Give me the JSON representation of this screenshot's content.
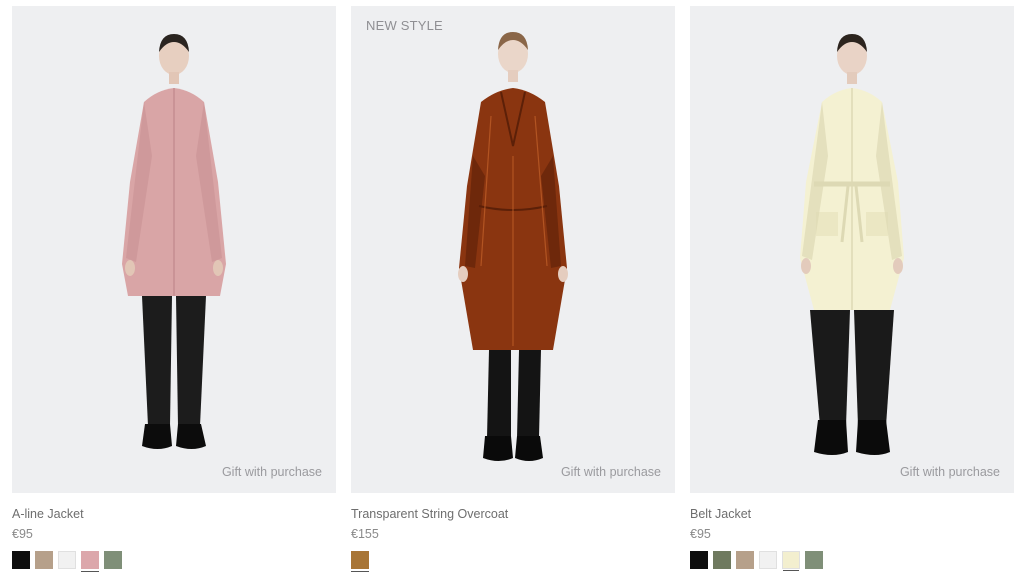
{
  "products": [
    {
      "name": "A-line Jacket",
      "price": "€95",
      "badge": "",
      "gift": "Gift with purchase",
      "coat_color": "#d9a5a6",
      "coat_shade": "#c58d90",
      "swatches": [
        "#0e0e0e",
        "#b6a08a",
        "#f1f1f1",
        "#dca7ab",
        "#7f8f78"
      ]
    },
    {
      "name": "Transparent String Overcoat",
      "price": "€155",
      "badge": "NEW STYLE",
      "gift": "Gift with purchase",
      "coat_color": "#8a3510",
      "coat_shade": "#5c2008",
      "swatches": [
        "#a87535"
      ]
    },
    {
      "name": "Belt Jacket",
      "price": "€95",
      "badge": "",
      "gift": "Gift with purchase",
      "coat_color": "#f4f1d2",
      "coat_shade": "#ddd9b4",
      "swatches": [
        "#0e0e0e",
        "#6f7a5f",
        "#b6a08a",
        "#f1f1f1",
        "#f3efcf",
        "#7f8f78"
      ]
    }
  ]
}
